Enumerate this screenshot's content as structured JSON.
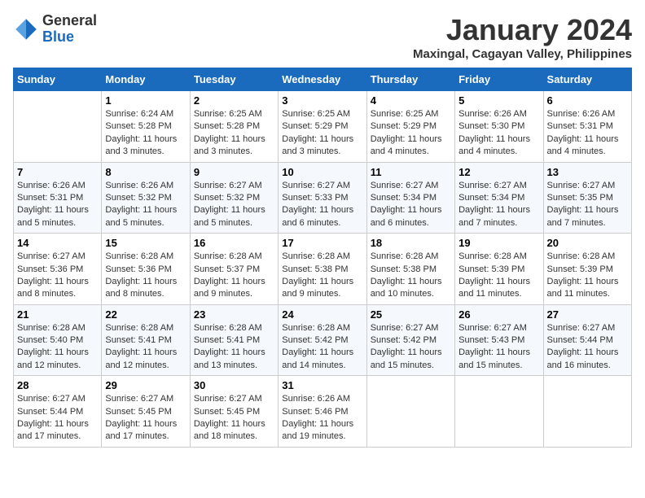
{
  "header": {
    "logo_general": "General",
    "logo_blue": "Blue",
    "month_title": "January 2024",
    "location": "Maxingal, Cagayan Valley, Philippines"
  },
  "days_of_week": [
    "Sunday",
    "Monday",
    "Tuesday",
    "Wednesday",
    "Thursday",
    "Friday",
    "Saturday"
  ],
  "weeks": [
    [
      {
        "day": "",
        "info": ""
      },
      {
        "day": "1",
        "info": "Sunrise: 6:24 AM\nSunset: 5:28 PM\nDaylight: 11 hours\nand 3 minutes."
      },
      {
        "day": "2",
        "info": "Sunrise: 6:25 AM\nSunset: 5:28 PM\nDaylight: 11 hours\nand 3 minutes."
      },
      {
        "day": "3",
        "info": "Sunrise: 6:25 AM\nSunset: 5:29 PM\nDaylight: 11 hours\nand 3 minutes."
      },
      {
        "day": "4",
        "info": "Sunrise: 6:25 AM\nSunset: 5:29 PM\nDaylight: 11 hours\nand 4 minutes."
      },
      {
        "day": "5",
        "info": "Sunrise: 6:26 AM\nSunset: 5:30 PM\nDaylight: 11 hours\nand 4 minutes."
      },
      {
        "day": "6",
        "info": "Sunrise: 6:26 AM\nSunset: 5:31 PM\nDaylight: 11 hours\nand 4 minutes."
      }
    ],
    [
      {
        "day": "7",
        "info": "Sunrise: 6:26 AM\nSunset: 5:31 PM\nDaylight: 11 hours\nand 5 minutes."
      },
      {
        "day": "8",
        "info": "Sunrise: 6:26 AM\nSunset: 5:32 PM\nDaylight: 11 hours\nand 5 minutes."
      },
      {
        "day": "9",
        "info": "Sunrise: 6:27 AM\nSunset: 5:32 PM\nDaylight: 11 hours\nand 5 minutes."
      },
      {
        "day": "10",
        "info": "Sunrise: 6:27 AM\nSunset: 5:33 PM\nDaylight: 11 hours\nand 6 minutes."
      },
      {
        "day": "11",
        "info": "Sunrise: 6:27 AM\nSunset: 5:34 PM\nDaylight: 11 hours\nand 6 minutes."
      },
      {
        "day": "12",
        "info": "Sunrise: 6:27 AM\nSunset: 5:34 PM\nDaylight: 11 hours\nand 7 minutes."
      },
      {
        "day": "13",
        "info": "Sunrise: 6:27 AM\nSunset: 5:35 PM\nDaylight: 11 hours\nand 7 minutes."
      }
    ],
    [
      {
        "day": "14",
        "info": "Sunrise: 6:27 AM\nSunset: 5:36 PM\nDaylight: 11 hours\nand 8 minutes."
      },
      {
        "day": "15",
        "info": "Sunrise: 6:28 AM\nSunset: 5:36 PM\nDaylight: 11 hours\nand 8 minutes."
      },
      {
        "day": "16",
        "info": "Sunrise: 6:28 AM\nSunset: 5:37 PM\nDaylight: 11 hours\nand 9 minutes."
      },
      {
        "day": "17",
        "info": "Sunrise: 6:28 AM\nSunset: 5:38 PM\nDaylight: 11 hours\nand 9 minutes."
      },
      {
        "day": "18",
        "info": "Sunrise: 6:28 AM\nSunset: 5:38 PM\nDaylight: 11 hours\nand 10 minutes."
      },
      {
        "day": "19",
        "info": "Sunrise: 6:28 AM\nSunset: 5:39 PM\nDaylight: 11 hours\nand 11 minutes."
      },
      {
        "day": "20",
        "info": "Sunrise: 6:28 AM\nSunset: 5:39 PM\nDaylight: 11 hours\nand 11 minutes."
      }
    ],
    [
      {
        "day": "21",
        "info": "Sunrise: 6:28 AM\nSunset: 5:40 PM\nDaylight: 11 hours\nand 12 minutes."
      },
      {
        "day": "22",
        "info": "Sunrise: 6:28 AM\nSunset: 5:41 PM\nDaylight: 11 hours\nand 12 minutes."
      },
      {
        "day": "23",
        "info": "Sunrise: 6:28 AM\nSunset: 5:41 PM\nDaylight: 11 hours\nand 13 minutes."
      },
      {
        "day": "24",
        "info": "Sunrise: 6:28 AM\nSunset: 5:42 PM\nDaylight: 11 hours\nand 14 minutes."
      },
      {
        "day": "25",
        "info": "Sunrise: 6:27 AM\nSunset: 5:42 PM\nDaylight: 11 hours\nand 15 minutes."
      },
      {
        "day": "26",
        "info": "Sunrise: 6:27 AM\nSunset: 5:43 PM\nDaylight: 11 hours\nand 15 minutes."
      },
      {
        "day": "27",
        "info": "Sunrise: 6:27 AM\nSunset: 5:44 PM\nDaylight: 11 hours\nand 16 minutes."
      }
    ],
    [
      {
        "day": "28",
        "info": "Sunrise: 6:27 AM\nSunset: 5:44 PM\nDaylight: 11 hours\nand 17 minutes."
      },
      {
        "day": "29",
        "info": "Sunrise: 6:27 AM\nSunset: 5:45 PM\nDaylight: 11 hours\nand 17 minutes."
      },
      {
        "day": "30",
        "info": "Sunrise: 6:27 AM\nSunset: 5:45 PM\nDaylight: 11 hours\nand 18 minutes."
      },
      {
        "day": "31",
        "info": "Sunrise: 6:26 AM\nSunset: 5:46 PM\nDaylight: 11 hours\nand 19 minutes."
      },
      {
        "day": "",
        "info": ""
      },
      {
        "day": "",
        "info": ""
      },
      {
        "day": "",
        "info": ""
      }
    ]
  ]
}
